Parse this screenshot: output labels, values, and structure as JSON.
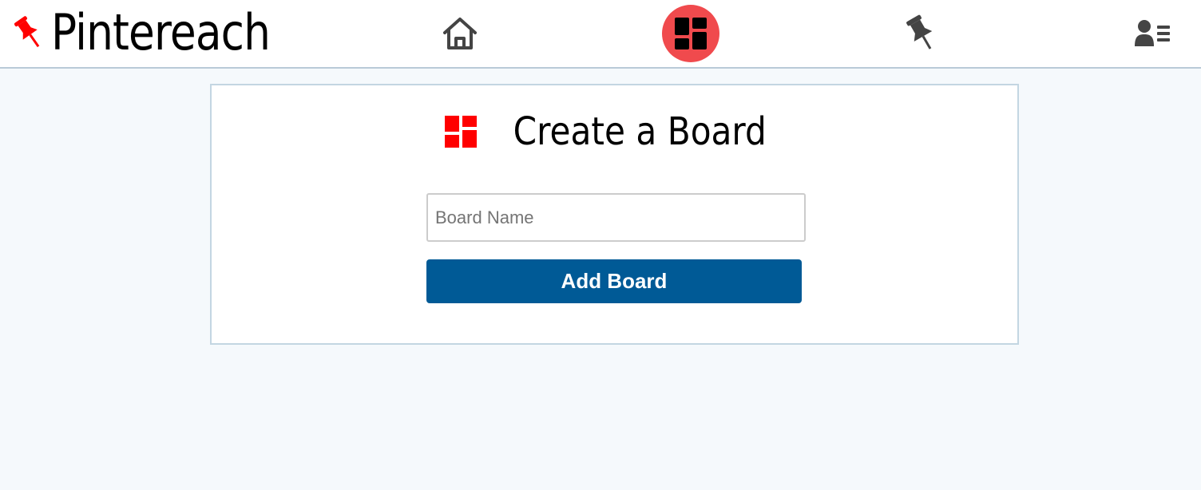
{
  "app": {
    "name": "Pintereach",
    "accent_color": "#f04a4d",
    "brand_red": "#ff0000"
  },
  "nav": {
    "items": [
      {
        "icon": "home-icon",
        "active": false
      },
      {
        "icon": "boards-icon",
        "active": true
      },
      {
        "icon": "pin-icon",
        "active": false
      },
      {
        "icon": "profile-icon",
        "active": false
      }
    ]
  },
  "form": {
    "title": "Create a Board",
    "title_icon": "boards-icon",
    "input_placeholder": "Board Name",
    "input_value": "",
    "submit_label": "Add Board",
    "submit_color": "#005a96"
  }
}
